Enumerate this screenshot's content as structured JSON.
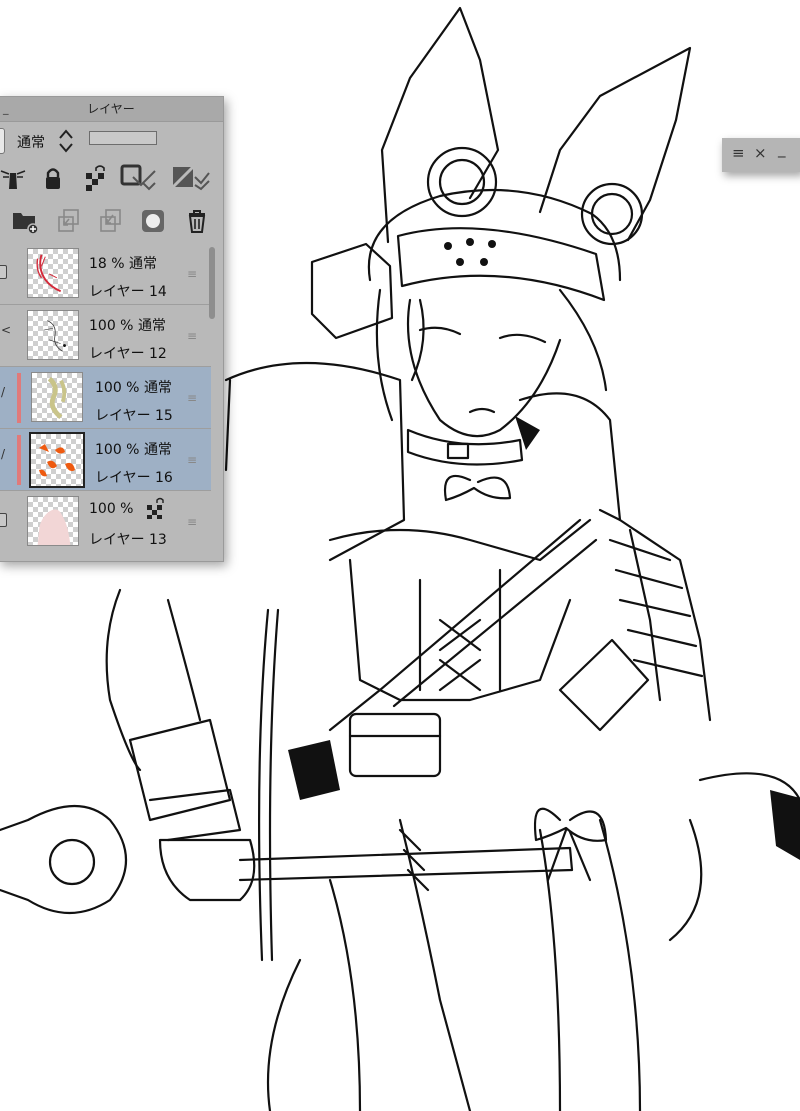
{
  "layer_panel": {
    "title": "レイヤー",
    "blend_mode": "通常",
    "layers": [
      {
        "opacity": "18 %",
        "mode": "通常",
        "name": "レイヤー 14",
        "selected": false
      },
      {
        "opacity": "100 %",
        "mode": "通常",
        "name": "レイヤー 12",
        "selected": false
      },
      {
        "opacity": "100 %",
        "mode": "通常",
        "name": "レイヤー 15",
        "selected": true
      },
      {
        "opacity": "100 %",
        "mode": "通常",
        "name": "レイヤー 16",
        "selected": true
      },
      {
        "opacity": "100 %",
        "mode": "",
        "name": "レイヤー 13",
        "selected": false
      }
    ]
  },
  "mini_panel": {
    "menu": "≡",
    "close": "×",
    "minimize": "_"
  },
  "colors": {
    "panel_bg": "#b9b9b9",
    "selected_row": "#9eb0c5",
    "accent_bar": "#e07a7a"
  }
}
